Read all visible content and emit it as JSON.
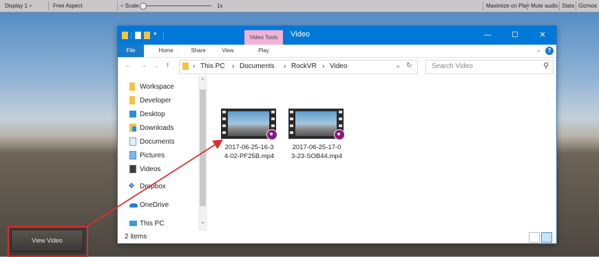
{
  "unity_toolbar": {
    "display": "Display 1",
    "aspect": "Free Aspect",
    "scale_label": "Scale",
    "scale_value": "1x",
    "maximize": "Maximize on Play",
    "mute": "Mute audio",
    "stats": "Stats",
    "gizmos": "Gizmos"
  },
  "explorer": {
    "title": "Video",
    "context_tab": "Video Tools",
    "ribbon_tabs": [
      "File",
      "Home",
      "Share",
      "View",
      "Play"
    ],
    "breadcrumb": [
      "This PC",
      "Documents",
      "RockVR",
      "Video"
    ],
    "search_placeholder": "Search Video",
    "nav_items": [
      {
        "label": "Workspace",
        "icon": "folder-icon",
        "pinned": true
      },
      {
        "label": "Developer",
        "icon": "folder-icon",
        "pinned": true
      },
      {
        "label": "Desktop",
        "icon": "desktop-icon",
        "pinned": true
      },
      {
        "label": "Downloads",
        "icon": "downloads-icon",
        "pinned": true
      },
      {
        "label": "Documents",
        "icon": "documents-icon",
        "pinned": true
      },
      {
        "label": "Pictures",
        "icon": "pictures-icon",
        "pinned": true
      },
      {
        "label": "Videos",
        "icon": "videos-icon",
        "pinned": true
      },
      {
        "label": "Dropbox",
        "icon": "dropbox-icon",
        "pinned": false
      },
      {
        "label": "OneDrive",
        "icon": "onedrive-icon",
        "pinned": false
      },
      {
        "label": "This PC",
        "icon": "this-pc-icon",
        "pinned": false
      }
    ],
    "files": [
      {
        "line1": "2017-06-25-16-3",
        "line2": "4-02-PF25B.mp4"
      },
      {
        "line1": "2017-06-25-17-0",
        "line2": "3-23-SOB44.mp4"
      }
    ],
    "status": "2 items"
  },
  "game_ui": {
    "view_video_label": "View Video"
  },
  "colors": {
    "accent": "#0078d7",
    "context_tab": "#f1b3d9",
    "annotation": "#e02c2c"
  }
}
